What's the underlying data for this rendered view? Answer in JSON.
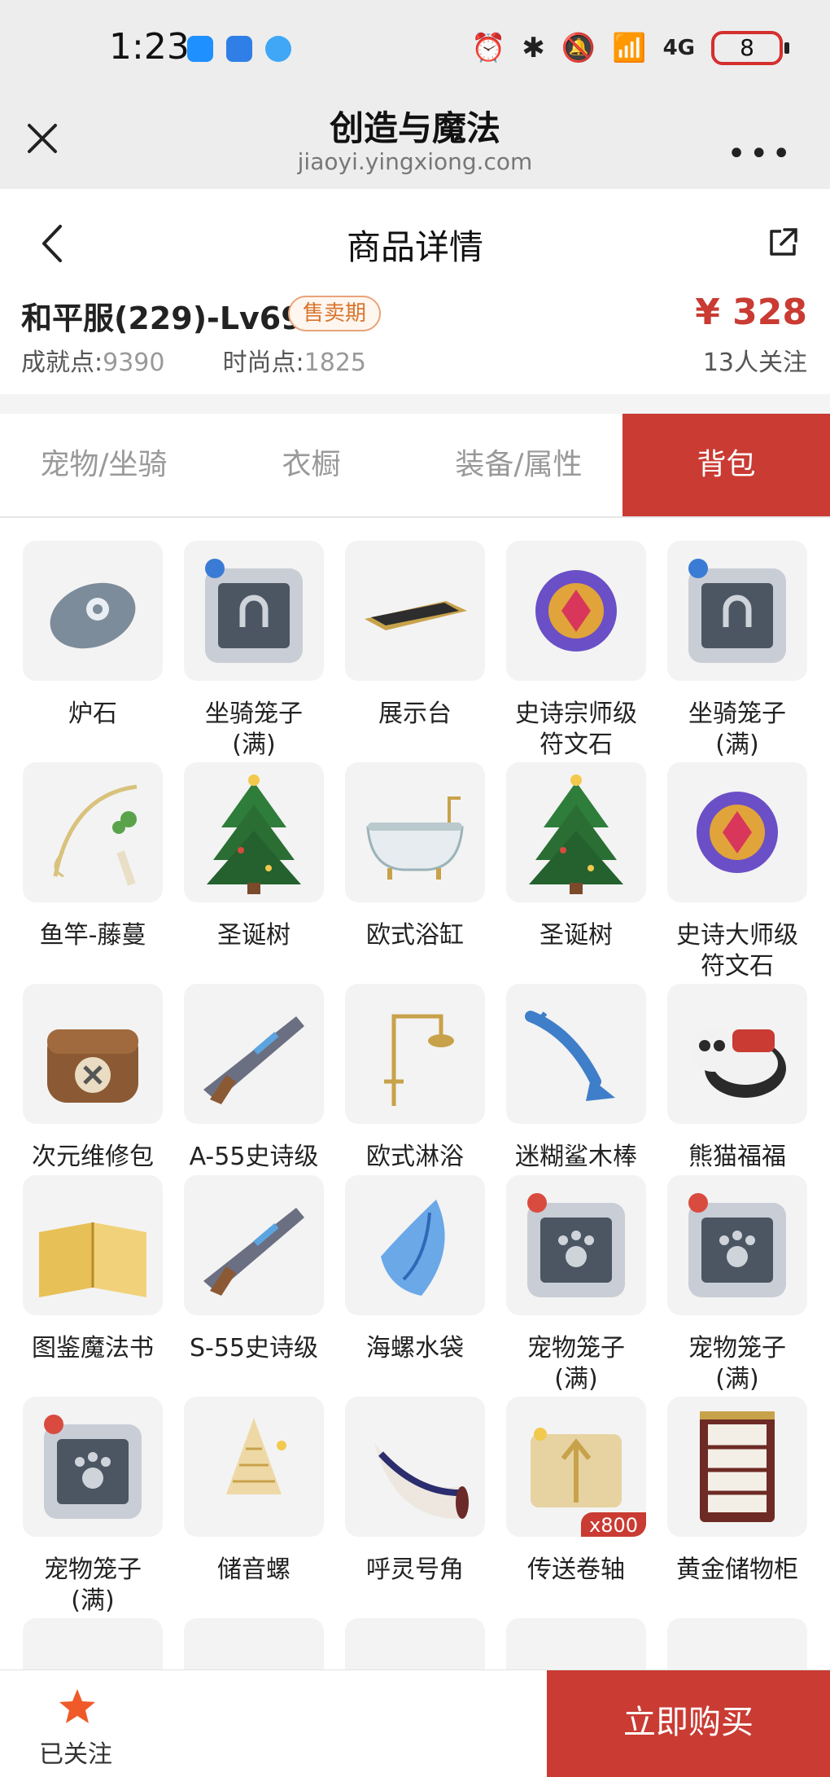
{
  "status_bar": {
    "time": "1:23",
    "battery": "8",
    "network": "4G"
  },
  "browser": {
    "title": "创造与魔法",
    "url": "jiaoyi.yingxiong.com"
  },
  "page_nav": {
    "title": "商品详情"
  },
  "product": {
    "name": "和平服(229)-Lv69",
    "status_badge": "售卖期",
    "price": "¥ 328",
    "followers": "13人关注",
    "achievement_label": "成就点:",
    "achievement_value": "9390",
    "fashion_label": "时尚点:",
    "fashion_value": "1825"
  },
  "tabs": [
    {
      "label": "宠物/坐骑"
    },
    {
      "label": "衣橱"
    },
    {
      "label": "装备/属性"
    },
    {
      "label": "背包"
    }
  ],
  "items": [
    {
      "name": "炉石",
      "icon": "hearthstone-icon"
    },
    {
      "name": "坐骑笼子\n(满)",
      "icon": "mount-cage-icon"
    },
    {
      "name": "展示台",
      "icon": "display-stand-icon"
    },
    {
      "name": "史诗宗师级\n符文石",
      "icon": "epic-rune-stone-icon"
    },
    {
      "name": "坐骑笼子\n(满)",
      "icon": "mount-cage-icon"
    },
    {
      "name": "鱼竿-藤蔓",
      "icon": "fishing-rod-icon"
    },
    {
      "name": "圣诞树",
      "icon": "christmas-tree-icon"
    },
    {
      "name": "欧式浴缸",
      "icon": "bathtub-icon"
    },
    {
      "name": "圣诞树",
      "icon": "christmas-tree-icon"
    },
    {
      "name": "史诗大师级\n符文石",
      "icon": "epic-rune-stone-icon"
    },
    {
      "name": "次元维修包",
      "icon": "repair-bag-icon"
    },
    {
      "name": "A-55史诗级",
      "icon": "gun-icon"
    },
    {
      "name": "欧式淋浴",
      "icon": "shower-icon"
    },
    {
      "name": "迷糊鲨木棒",
      "icon": "shark-club-icon"
    },
    {
      "name": "熊猫福福",
      "icon": "panda-icon"
    },
    {
      "name": "图鉴魔法书",
      "icon": "magic-book-icon"
    },
    {
      "name": "S-55史诗级",
      "icon": "gun-icon"
    },
    {
      "name": "海螺水袋",
      "icon": "conch-water-bag-icon"
    },
    {
      "name": "宠物笼子\n(满)",
      "icon": "pet-cage-icon"
    },
    {
      "name": "宠物笼子\n(满)",
      "icon": "pet-cage-icon"
    },
    {
      "name": "宠物笼子\n(满)",
      "icon": "pet-cage-icon"
    },
    {
      "name": "储音螺",
      "icon": "sound-conch-icon"
    },
    {
      "name": "呼灵号角",
      "icon": "horn-icon"
    },
    {
      "name": "传送卷轴",
      "icon": "teleport-scroll-icon",
      "qty": "x800"
    },
    {
      "name": "黄金储物柜",
      "icon": "cabinet-icon"
    }
  ],
  "bottom_bar": {
    "followed_label": "已关注",
    "buy_label": "立即购买"
  },
  "colors": {
    "accent": "#c93b33",
    "badge_text": "#d8752f",
    "tile_bg": "#f3f3f3"
  }
}
